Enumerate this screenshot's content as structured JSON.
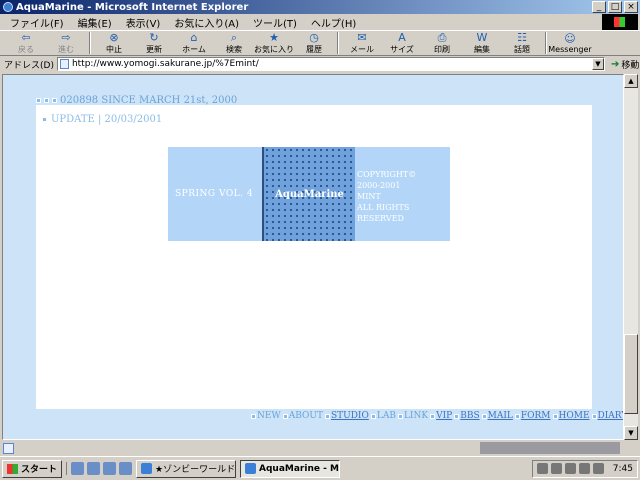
{
  "window": {
    "title": "AquaMarine - Microsoft Internet Explorer",
    "min_label": "_",
    "max_label": "□",
    "close_label": "×"
  },
  "menu": [
    "ファイル(F)",
    "編集(E)",
    "表示(V)",
    "お気に入り(A)",
    "ツール(T)",
    "ヘルプ(H)"
  ],
  "toolbar": [
    {
      "label": "戻る",
      "icon": "back-arrow-icon",
      "glyph": "⇦",
      "disabled": true
    },
    {
      "label": "進む",
      "icon": "forward-arrow-icon",
      "glyph": "⇨",
      "disabled": true
    },
    {
      "label": "中止",
      "icon": "stop-icon",
      "glyph": "⊗",
      "disabled": false
    },
    {
      "label": "更新",
      "icon": "refresh-icon",
      "glyph": "↻",
      "disabled": false
    },
    {
      "label": "ホーム",
      "icon": "home-icon",
      "glyph": "⌂",
      "disabled": false
    },
    {
      "label": "検索",
      "icon": "search-icon",
      "glyph": "⌕",
      "disabled": false
    },
    {
      "label": "お気に入り",
      "icon": "favorites-icon",
      "glyph": "★",
      "disabled": false
    },
    {
      "label": "履歴",
      "icon": "history-icon",
      "glyph": "◷",
      "disabled": false
    },
    {
      "label": "メール",
      "icon": "mail-icon",
      "glyph": "✉",
      "disabled": false
    },
    {
      "label": "サイズ",
      "icon": "font-size-icon",
      "glyph": "A",
      "disabled": false
    },
    {
      "label": "印刷",
      "icon": "print-icon",
      "glyph": "⎙",
      "disabled": false
    },
    {
      "label": "編集",
      "icon": "edit-icon",
      "glyph": "W",
      "disabled": false
    },
    {
      "label": "話題",
      "icon": "discuss-icon",
      "glyph": "☷",
      "disabled": false
    },
    {
      "label": "Messenger",
      "icon": "messenger-icon",
      "glyph": "☺",
      "disabled": false
    }
  ],
  "address": {
    "label": "アドレス(D)",
    "url": "http://www.yomogi.sakurane.jp/%7Emint/",
    "go_label": "移動"
  },
  "page": {
    "counter": "020898 SINCE MARCH 21st, 2000",
    "update": "UPDATE | 20/03/2001",
    "banner_left": "SPRING VOL. 4",
    "banner_mid": "AquaMarine",
    "banner_right": [
      "COPYRIGHT©",
      "2000-2001",
      "MINT",
      "ALL RIGHTS",
      "RESERVED"
    ],
    "nav": [
      {
        "label": "NEW",
        "active": false
      },
      {
        "label": "ABOUT",
        "active": false
      },
      {
        "label": "STUDIO",
        "active": true
      },
      {
        "label": "LAB",
        "active": false
      },
      {
        "label": "LINK",
        "active": false
      },
      {
        "label": "VIP",
        "active": true
      },
      {
        "label": "BBS",
        "active": true
      },
      {
        "label": "MAIL",
        "active": true
      },
      {
        "label": "FORM",
        "active": true
      },
      {
        "label": "HOME",
        "active": true
      },
      {
        "label": "DIARY",
        "active": true
      }
    ]
  },
  "taskbar": {
    "start_label": "スタート",
    "tasks": [
      {
        "label": "★ゾンビーワールド★ - Mi...",
        "active": false
      },
      {
        "label": "AquaMarine - Micro...",
        "active": true
      }
    ],
    "clock": "7:45"
  },
  "colors": {
    "page_bg": "#cde3f8",
    "link_light": "#6aa3d8",
    "link_active": "#3c74c2",
    "banner_light": "#b3d6f8",
    "banner_mid": "#6fa2dc"
  }
}
